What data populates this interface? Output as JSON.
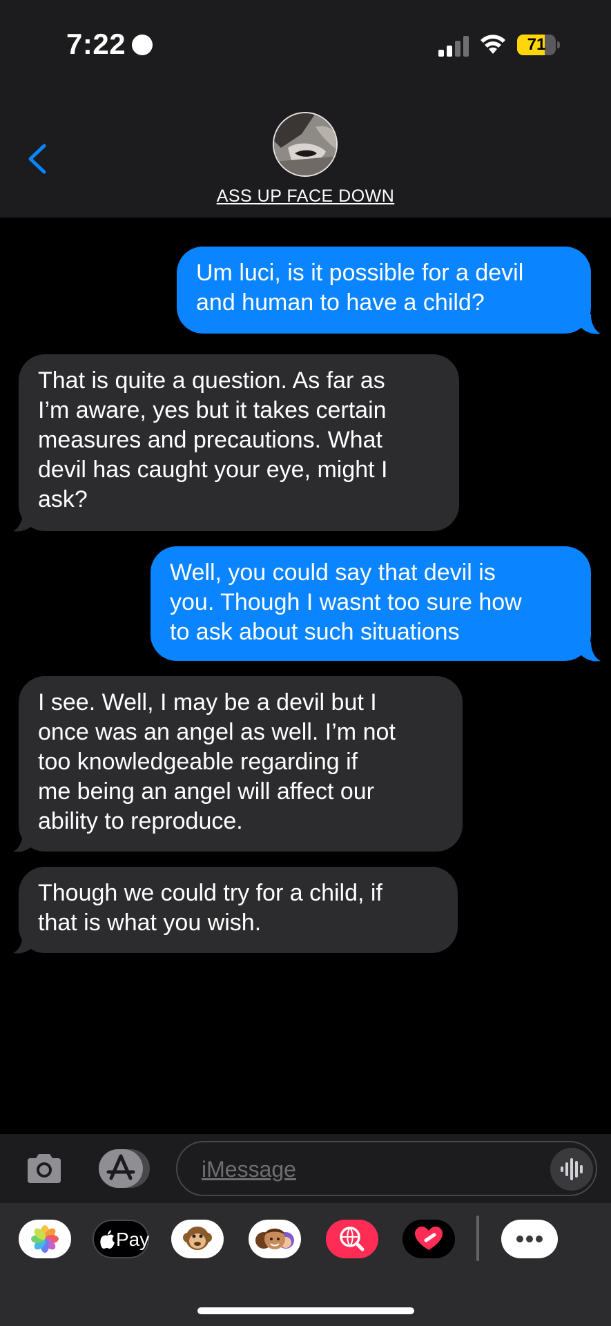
{
  "status_bar": {
    "time": "7:22",
    "battery_level": "71",
    "battery_fraction": 0.71
  },
  "header": {
    "contact_name": "ASS UP FACE DOWN"
  },
  "messages": [
    {
      "direction": "sent",
      "text": "Um luci, is it possible for a devil\nand human to have a child?"
    },
    {
      "direction": "received",
      "text": "That is quite a question. As far as\nI’m aware, yes but it takes certain\nmeasures and precautions. What\ndevil has caught your eye, might I\nask?"
    },
    {
      "direction": "sent",
      "text": "Well, you could say that devil is\nyou. Though I wasnt too sure how\nto ask about such situations"
    },
    {
      "direction": "received",
      "text": "I see. Well, I may be a devil but I\nonce was an angel as well. I’m not\ntoo knowledgeable regarding if\nme being an angel will affect our\nability to reproduce."
    },
    {
      "direction": "received",
      "text": "Though we could try for a child, if\nthat is what you wish."
    }
  ],
  "input": {
    "placeholder": "iMessage"
  },
  "app_drawer": {
    "pay_label": "Pay",
    "apps": [
      "photos-app",
      "apple-pay-app",
      "memoji-stickers-app",
      "memoji-app",
      "image-search-app",
      "digital-touch-app",
      "more-apps"
    ]
  },
  "colors": {
    "sent_bubble": "#0a84ff",
    "received_bubble": "#2c2c2e",
    "header_bg": "#1c1c1e",
    "battery": "#ffd60a"
  }
}
